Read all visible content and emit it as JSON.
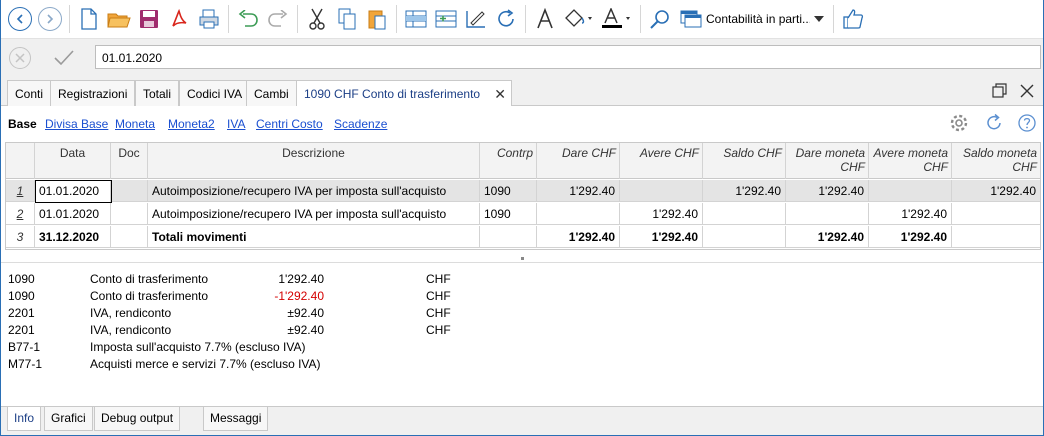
{
  "toolbar": {
    "combo_label": "Contabilità in parti...",
    "icons": [
      "back-icon",
      "forward-icon",
      "new-file-icon",
      "open-folder-icon",
      "save-icon",
      "pdf-icon",
      "print-icon",
      "undo-icon",
      "redo-icon",
      "cut-icon",
      "copy-icon",
      "paste-icon",
      "insert-row-icon",
      "add-rows-icon",
      "edit-icon",
      "refresh-icon",
      "font-icon",
      "fill-color-icon",
      "text-color-icon",
      "search-icon",
      "window-select-icon",
      "thumbs-up-icon"
    ],
    "accent_color": "#2a6fb5"
  },
  "editbar": {
    "value": "01.01.2020"
  },
  "tabs": [
    {
      "label": "Conti"
    },
    {
      "label": "Registrazioni"
    },
    {
      "label": "Totali"
    },
    {
      "label": "Codici IVA"
    },
    {
      "label": "Cambi"
    },
    {
      "label": "1090 CHF Conto di trasferimento"
    }
  ],
  "views": [
    {
      "label": "Base"
    },
    {
      "label": "Divisa Base"
    },
    {
      "label": "Moneta"
    },
    {
      "label": "Moneta2"
    },
    {
      "label": "IVA"
    },
    {
      "label": "Centri Costo"
    },
    {
      "label": "Scadenze"
    }
  ],
  "table": {
    "columns": [
      {
        "label": "Data"
      },
      {
        "label": "Doc"
      },
      {
        "label": "Descrizione"
      },
      {
        "label": "Contrp"
      },
      {
        "label": "Dare CHF"
      },
      {
        "label": "Avere CHF"
      },
      {
        "label": "Saldo CHF"
      },
      {
        "label": "Dare moneta",
        "label2": "CHF"
      },
      {
        "label": "Avere moneta",
        "label2": "CHF"
      },
      {
        "label": "Saldo moneta",
        "label2": "CHF"
      }
    ],
    "rows": [
      {
        "num": "1",
        "data": "01.01.2020",
        "doc": "",
        "desc": "Autoimposizione/recupero IVA per imposta sull'acquisto",
        "contrp": "1090",
        "dare": "1'292.40",
        "avere": "",
        "saldo": "1'292.40",
        "dare_m": "1'292.40",
        "avere_m": "",
        "saldo_m": "1'292.40"
      },
      {
        "num": "2",
        "data": "01.01.2020",
        "doc": "",
        "desc": "Autoimposizione/recupero IVA per imposta sull'acquisto",
        "contrp": "1090",
        "dare": "",
        "avere": "1'292.40",
        "saldo": "",
        "dare_m": "",
        "avere_m": "1'292.40",
        "saldo_m": ""
      },
      {
        "num": "3",
        "data": "31.12.2020",
        "doc": "",
        "desc": "Totali movimenti",
        "contrp": "",
        "dare": "1'292.40",
        "avere": "1'292.40",
        "saldo": "",
        "dare_m": "1'292.40",
        "avere_m": "1'292.40",
        "saldo_m": ""
      }
    ]
  },
  "info": {
    "lines": [
      {
        "code": "1090",
        "desc": "Conto di trasferimento",
        "amount": "1'292.40",
        "currency": "CHF"
      },
      {
        "code": "1090",
        "desc": "Conto di trasferimento",
        "amount": "-1'292.40",
        "currency": "CHF"
      },
      {
        "code": "2201",
        "desc": "IVA, rendiconto",
        "amount": "±92.40",
        "currency": "CHF"
      },
      {
        "code": "2201",
        "desc": "IVA, rendiconto",
        "amount": "±92.40",
        "currency": "CHF"
      },
      {
        "code": "B77-1",
        "desc": "Imposta sull'acquisto 7.7% (escluso IVA)",
        "amount": "",
        "currency": ""
      },
      {
        "code": "M77-1",
        "desc": "Acquisti merce e servizi 7.7% (escluso IVA)",
        "amount": "",
        "currency": ""
      }
    ],
    "negative_color": "#d40000"
  },
  "bottom_tabs": [
    {
      "label": "Info"
    },
    {
      "label": "Grafici"
    },
    {
      "label": "Debug output"
    },
    {
      "label": "Messaggi"
    }
  ]
}
